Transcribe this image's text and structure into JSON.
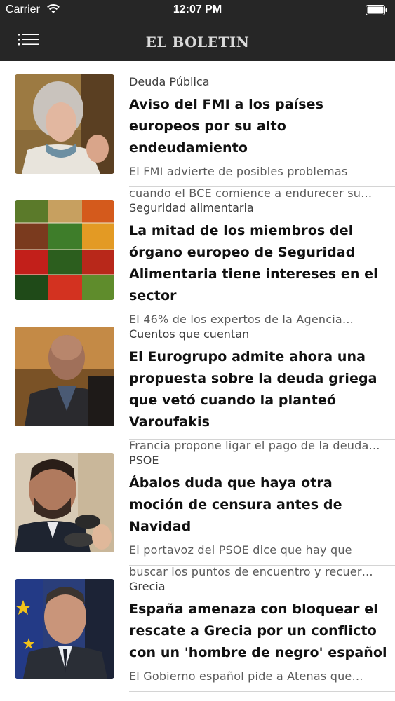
{
  "status_bar": {
    "carrier": "Carrier",
    "time": "12:07 PM"
  },
  "nav": {
    "title": "EL BOLETIN",
    "menu_icon": "hamburger-menu-icon"
  },
  "articles": [
    {
      "category": "Deuda Pública",
      "title": "Aviso del FMI a los países europeos por su alto endeudamiento",
      "summary": "El FMI advierte de posibles problemas cuando el BCE comience a endurecer su…",
      "image": "woman-grey-hair-photo"
    },
    {
      "category": "Seguridad alimentaria",
      "title": "La mitad de los miembros del órgano europeo de Seguridad Alimentaria tiene intereses en el sector",
      "summary": "El 46% de los expertos de la Agencia…",
      "image": "vegetable-market-photo"
    },
    {
      "category": "Cuentos que cuentan",
      "title": "El Eurogrupo admite ahora una propuesta sobre la deuda griega que vetó cuando la planteó Varoufakis",
      "summary": "Francia propone ligar el pago de la deuda…",
      "image": "bald-man-photo"
    },
    {
      "category": "PSOE",
      "title": "Ábalos duda que haya otra moción de censura antes de Navidad",
      "summary": "El portavoz del PSOE dice que hay que buscar los puntos de encuentro y recuer…",
      "image": "politician-microphones-photo"
    },
    {
      "category": "Grecia",
      "title": "España amenaza con bloquear el rescate a Grecia por un conflicto con un 'hombre de negro' español",
      "summary": "El Gobierno español pide a Atenas que…",
      "image": "man-with-eu-flag-photo"
    }
  ],
  "colors": {
    "header_bg": "#262626",
    "title_text": "#111111",
    "summary_text": "#5a5a5a",
    "separator": "#d4d4d4"
  }
}
